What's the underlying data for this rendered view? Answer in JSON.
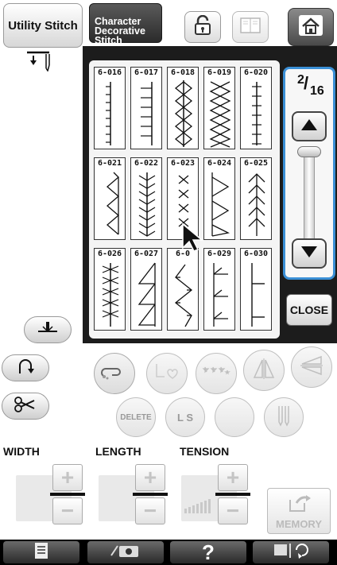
{
  "tabs": {
    "utility_label": "Utility Stitch",
    "character_label": "Character\nDecorative\nStitch"
  },
  "stitch_grid": {
    "rows": [
      [
        "6-016",
        "6-017",
        "6-018",
        "6-019",
        "6-020"
      ],
      [
        "6-021",
        "6-022",
        "6-023",
        "6-024",
        "6-025"
      ],
      [
        "6-026",
        "6-027",
        "6-0",
        "6-029",
        "6-030"
      ]
    ]
  },
  "page_indicator": {
    "current": "2",
    "total": "16"
  },
  "close_label": "CLOSE",
  "edit_buttons": {
    "delete_label": "DELETE",
    "ls_label": "L S"
  },
  "settings": {
    "width_label": "WIDTH",
    "length_label": "LENGTH",
    "tension_label": "TENSION",
    "plus": "+",
    "minus": "−"
  },
  "memory_label": "MEMORY",
  "bottom_bar": {
    "help_label": "?"
  },
  "colors": {
    "scroll_highlight": "#3a8fd6",
    "panel_bg": "#1c1c1c"
  },
  "icons": [
    "needle-position-icon",
    "lock-icon",
    "book-icon",
    "home-icon",
    "presser-foot-icon",
    "reverse-stitch-icon",
    "scissors-icon",
    "stitch-settings-icon",
    "camera-icon",
    "help-icon",
    "needle-mode-icon"
  ]
}
